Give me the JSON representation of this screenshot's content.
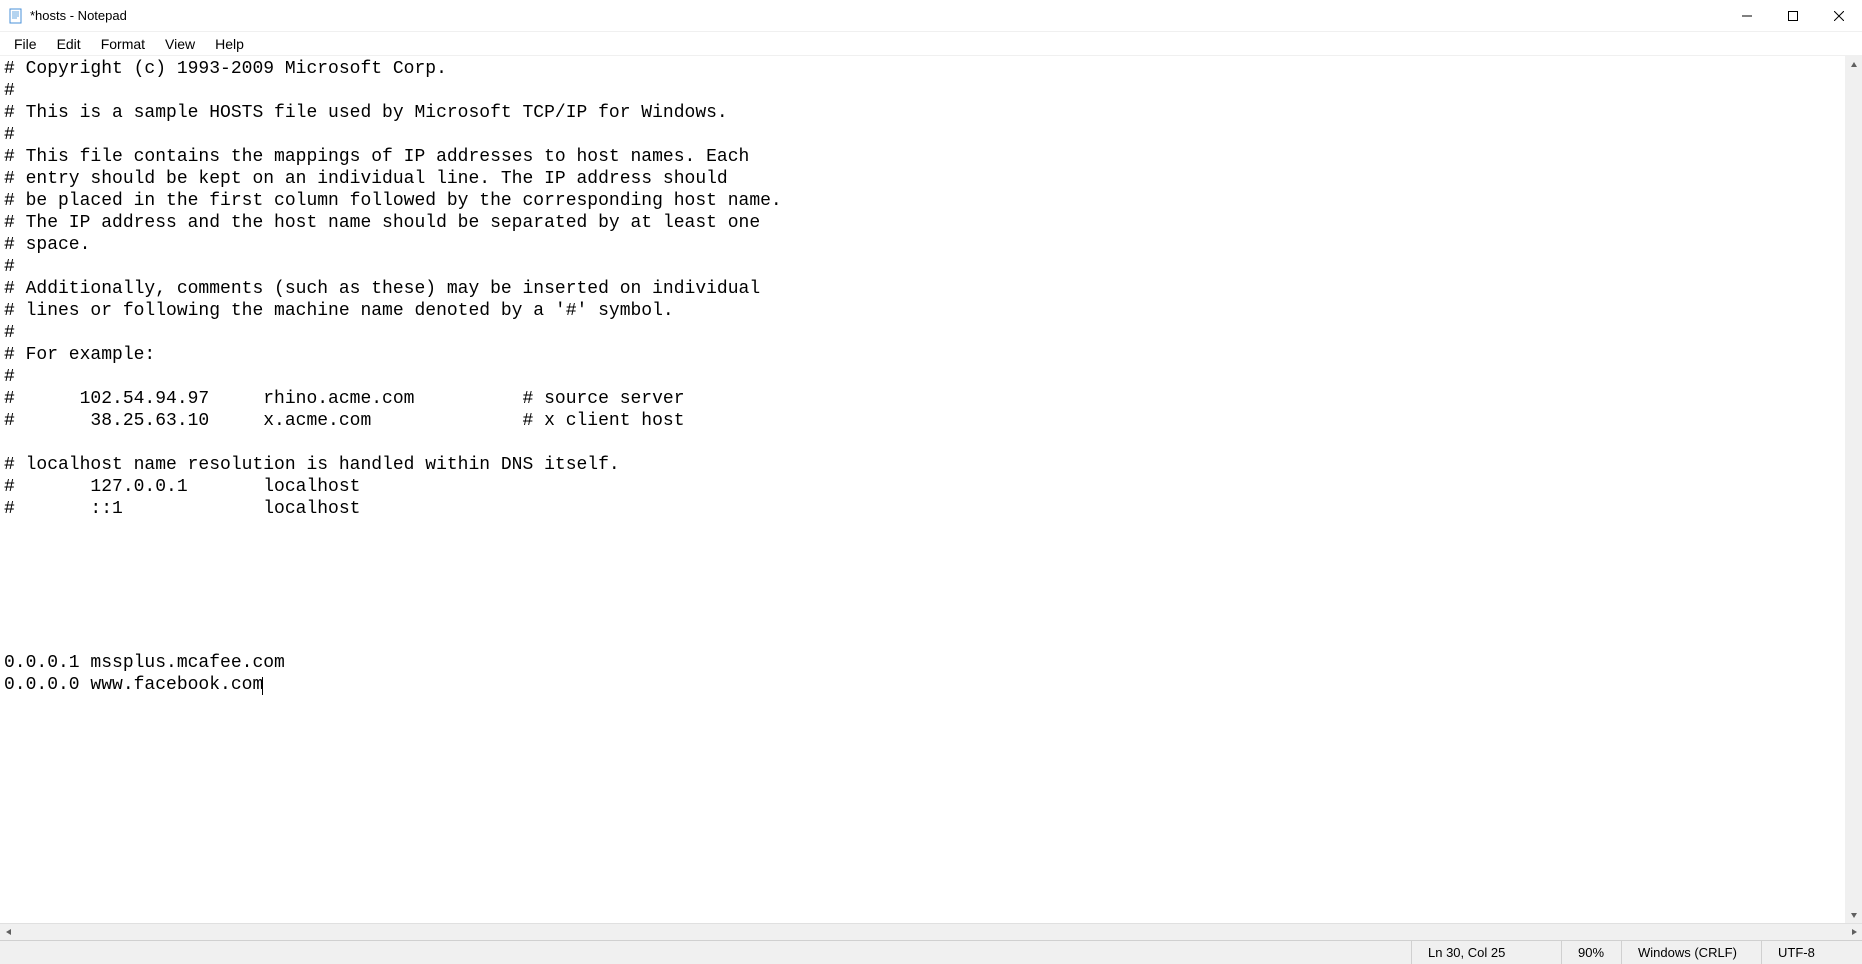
{
  "window": {
    "title": "*hosts - Notepad"
  },
  "menu": {
    "items": [
      "File",
      "Edit",
      "Format",
      "View",
      "Help"
    ]
  },
  "editor": {
    "content": "# Copyright (c) 1993-2009 Microsoft Corp.\n#\n# This is a sample HOSTS file used by Microsoft TCP/IP for Windows.\n#\n# This file contains the mappings of IP addresses to host names. Each\n# entry should be kept on an individual line. The IP address should\n# be placed in the first column followed by the corresponding host name.\n# The IP address and the host name should be separated by at least one\n# space.\n#\n# Additionally, comments (such as these) may be inserted on individual\n# lines or following the machine name denoted by a '#' symbol.\n#\n# For example:\n#\n#      102.54.94.97     rhino.acme.com          # source server\n#       38.25.63.10     x.acme.com              # x client host\n\n# localhost name resolution is handled within DNS itself.\n#       127.0.0.1       localhost\n#       ::1             localhost\n\n\n\n\n\n\n0.0.0.1 mssplus.mcafee.com\n0.0.0.0 www.facebook.com"
  },
  "status": {
    "position": "Ln 30, Col 25",
    "zoom": "90%",
    "line_ending": "Windows (CRLF)",
    "encoding": "UTF-8"
  }
}
